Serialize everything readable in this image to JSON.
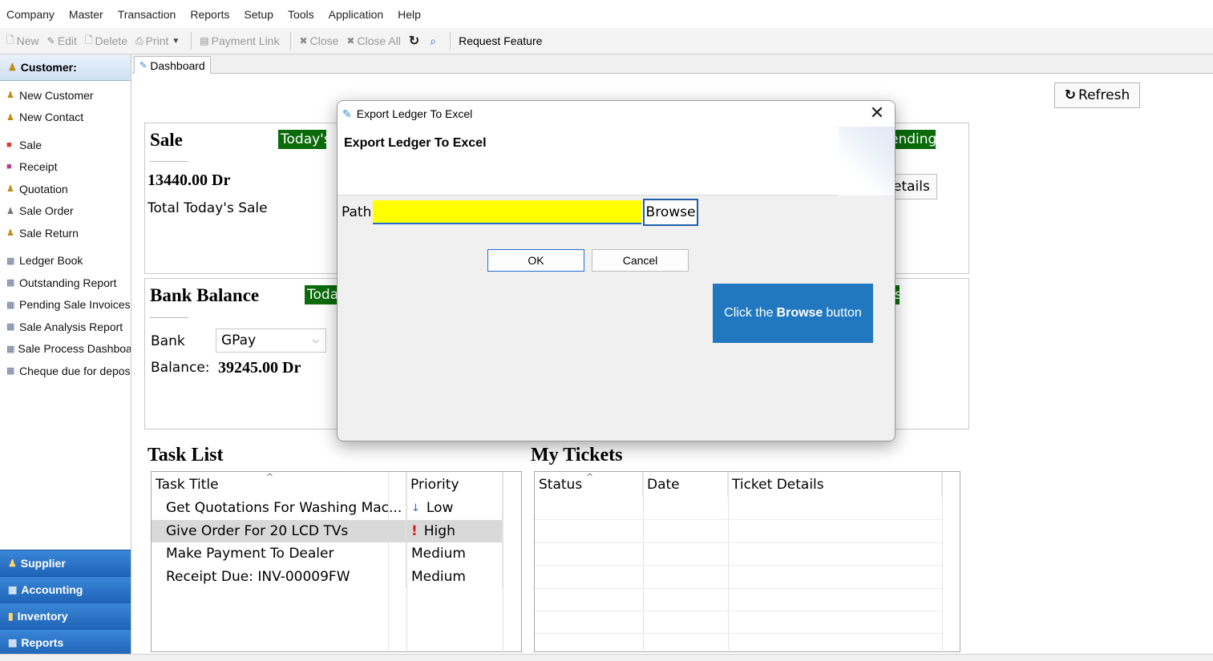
{
  "menu": [
    "Company",
    "Master",
    "Transaction",
    "Reports",
    "Setup",
    "Tools",
    "Application",
    "Help"
  ],
  "toolbar": {
    "new": "New",
    "edit": "Edit",
    "delete": "Delete",
    "print": "Print",
    "payment_link": "Payment Link",
    "close": "Close",
    "close_all": "Close All",
    "request_feature": "Request Feature"
  },
  "sidebar": {
    "header": "Customer:",
    "items": [
      {
        "label": "New Customer",
        "icon": "customer-icon"
      },
      {
        "label": "New Contact",
        "icon": "contact-icon"
      },
      {
        "label": "Sale",
        "icon": "sale-icon"
      },
      {
        "label": "Receipt",
        "icon": "receipt-icon"
      },
      {
        "label": "Quotation",
        "icon": "quotation-icon"
      },
      {
        "label": "Sale Order",
        "icon": "sale-order-icon"
      },
      {
        "label": "Sale Return",
        "icon": "sale-return-icon"
      },
      {
        "label": "Ledger Book",
        "icon": "report-icon"
      },
      {
        "label": "Outstanding Report",
        "icon": "report-icon"
      },
      {
        "label": "Pending Sale Invoices",
        "icon": "report-icon"
      },
      {
        "label": "Sale Analysis Report",
        "icon": "report-icon"
      },
      {
        "label": "Sale Process Dashboa",
        "icon": "report-icon"
      },
      {
        "label": "Cheque due for depos",
        "icon": "report-icon"
      }
    ],
    "modules": [
      "Supplier",
      "Accounting",
      "Inventory",
      "Reports"
    ]
  },
  "tabs": {
    "dashboard": "Dashboard"
  },
  "dashboard": {
    "refresh": "Refresh",
    "sale_card": {
      "title": "Sale",
      "badge": "Today's",
      "amount": "13440.00 Dr",
      "caption": "Total Today's Sale",
      "right_badge": "ending",
      "right_button": "etails"
    },
    "bank_card": {
      "title": "Bank Balance",
      "badge": "Toda",
      "bank_label": "Bank",
      "bank_value": "GPay",
      "balance_label": "Balance:",
      "balance_value": "39245.00 Dr",
      "right_badge": "s"
    },
    "task_list": {
      "title": "Task List",
      "columns": [
        "Task Title",
        "Priority"
      ],
      "rows": [
        {
          "title": "Get Quotations For Washing Mac...",
          "priority_icon": "↓",
          "priority": "Low"
        },
        {
          "title": "Give Order For 20 LCD TVs",
          "priority_icon": "!",
          "priority": "High"
        },
        {
          "title": "Make Payment To Dealer",
          "priority_icon": "",
          "priority": "Medium"
        },
        {
          "title": "Receipt Due: INV-00009FW",
          "priority_icon": "",
          "priority": "Medium"
        }
      ]
    },
    "my_tickets": {
      "title": "My Tickets",
      "columns": [
        "Status",
        "Date",
        "Ticket Details"
      ]
    }
  },
  "modal": {
    "window_title": "Export Ledger To Excel",
    "header": "Export Ledger To Excel",
    "path_label": "Path",
    "path_value": "",
    "browse": "Browse",
    "ok": "OK",
    "cancel": "Cancel"
  },
  "callout": {
    "prefix": "Click the",
    "bold": "Browse",
    "suffix": "button",
    "color": "#2278c0"
  },
  "colors": {
    "badge_green": "#0b6b0b",
    "module_blue": "#1f64b8",
    "path_highlight": "#ffff00"
  }
}
